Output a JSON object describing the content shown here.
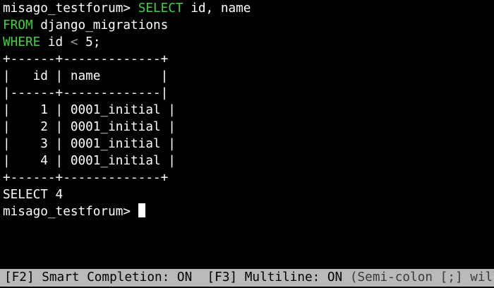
{
  "colors": {
    "background": "#000000",
    "text": "#ffffff",
    "keyword": "#3fd43f",
    "operator": "#9a9a9a",
    "toolbar_bg": "#b9b9b9",
    "toolbar_text": "#000000"
  },
  "query": {
    "prompt": "misago_testforum> ",
    "select_kw": "SELECT",
    "select_rest": " id, name",
    "from_kw": "FROM",
    "from_rest": " django_migrations",
    "where_kw": "WHERE",
    "where_col": " id ",
    "where_op": "<",
    "where_val": " 5;"
  },
  "result": {
    "border_top": "+------+-------------+",
    "header_row": "|   id | name        |",
    "separator": "|------+-------------|",
    "rows": [
      "|    1 | 0001_initial |",
      "|    2 | 0001_initial |",
      "|    3 | 0001_initial |",
      "|    4 | 0001_initial |"
    ],
    "border_bottom": "+------+-------------+",
    "status": "SELECT 4"
  },
  "next_prompt": "misago_testforum> ",
  "toolbar": {
    "smart_completion": "[F2] Smart Completion: ON",
    "multiline": "  [F3] Multiline: ON",
    "hint": " (Semi-colon [;] will e"
  }
}
